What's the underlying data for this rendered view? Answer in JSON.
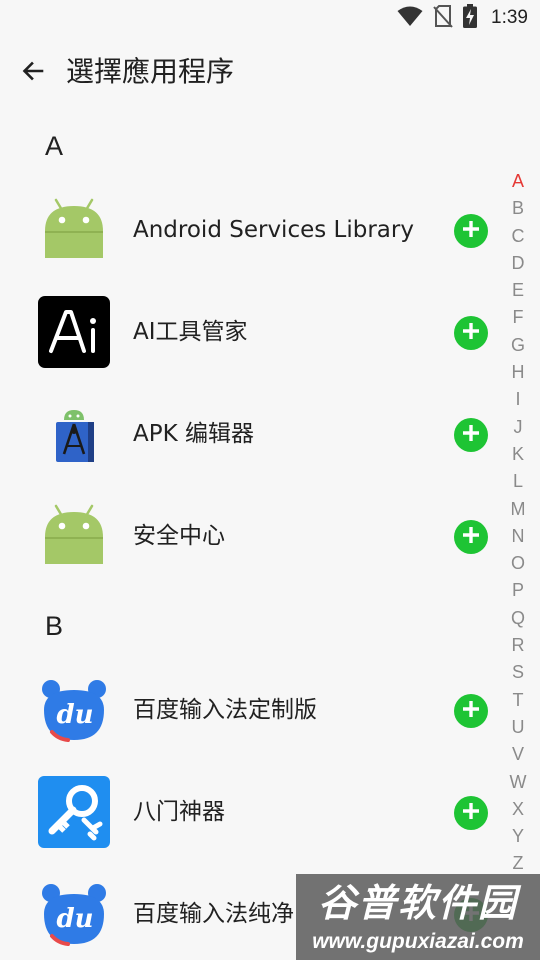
{
  "status_bar": {
    "time": "1:39",
    "icons": [
      "wifi-icon",
      "no-sim-icon",
      "battery-charging-icon"
    ]
  },
  "app_bar": {
    "back_icon": "arrow-left-icon",
    "title": "選擇應用程序"
  },
  "sections": [
    {
      "letter": "A",
      "apps": [
        {
          "name": "Android Services Library",
          "icon": "android-robot-icon"
        },
        {
          "name": "AI工具管家",
          "icon": "ai-tools-icon"
        },
        {
          "name": "APK 编辑器",
          "icon": "apk-editor-icon"
        },
        {
          "name": "安全中心",
          "icon": "android-robot-icon"
        }
      ]
    },
    {
      "letter": "B",
      "apps": [
        {
          "name": "百度输入法定制版",
          "icon": "baidu-input-icon"
        },
        {
          "name": "八门神器",
          "icon": "key-wrench-icon"
        },
        {
          "name": "百度输入法纯净",
          "icon": "baidu-input-icon"
        }
      ]
    }
  ],
  "add_button_icon": "plus-circle-icon",
  "alpha_index": {
    "letters": [
      "A",
      "B",
      "C",
      "D",
      "E",
      "F",
      "G",
      "H",
      "I",
      "J",
      "K",
      "L",
      "M",
      "N",
      "O",
      "P",
      "Q",
      "R",
      "S",
      "T",
      "U",
      "V",
      "W",
      "X",
      "Y",
      "Z"
    ],
    "active": "A"
  },
  "watermark": {
    "title": "谷普软件园",
    "url": "www.gupuxiazai.com"
  },
  "colors": {
    "add_green": "#1ec434",
    "android_green": "#a4c867",
    "baidu_blue": "#2f7be6",
    "index_active": "#e53935",
    "index_inactive": "#8a8a8a"
  }
}
